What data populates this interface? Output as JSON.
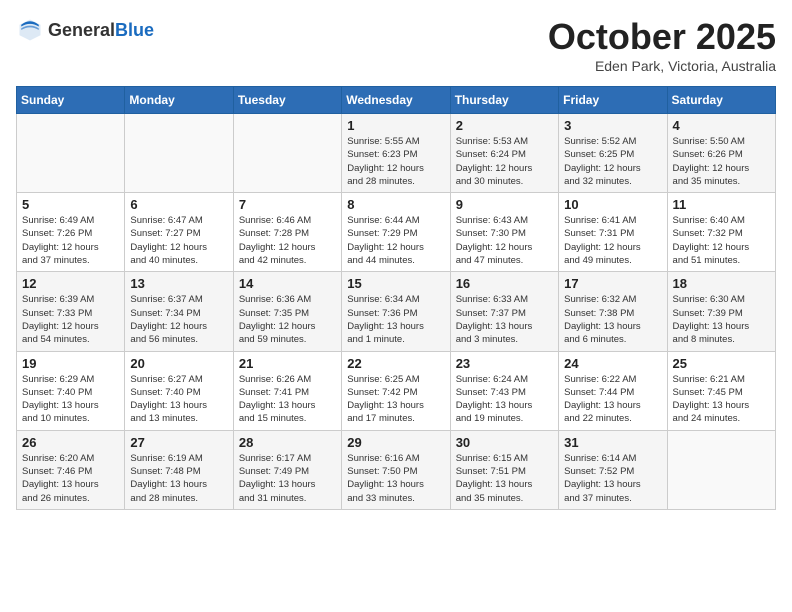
{
  "header": {
    "logo_general": "General",
    "logo_blue": "Blue",
    "title": "October 2025",
    "location": "Eden Park, Victoria, Australia"
  },
  "weekdays": [
    "Sunday",
    "Monday",
    "Tuesday",
    "Wednesday",
    "Thursday",
    "Friday",
    "Saturday"
  ],
  "weeks": [
    [
      {
        "day": "",
        "info": ""
      },
      {
        "day": "",
        "info": ""
      },
      {
        "day": "",
        "info": ""
      },
      {
        "day": "1",
        "info": "Sunrise: 5:55 AM\nSunset: 6:23 PM\nDaylight: 12 hours\nand 28 minutes."
      },
      {
        "day": "2",
        "info": "Sunrise: 5:53 AM\nSunset: 6:24 PM\nDaylight: 12 hours\nand 30 minutes."
      },
      {
        "day": "3",
        "info": "Sunrise: 5:52 AM\nSunset: 6:25 PM\nDaylight: 12 hours\nand 32 minutes."
      },
      {
        "day": "4",
        "info": "Sunrise: 5:50 AM\nSunset: 6:26 PM\nDaylight: 12 hours\nand 35 minutes."
      }
    ],
    [
      {
        "day": "5",
        "info": "Sunrise: 6:49 AM\nSunset: 7:26 PM\nDaylight: 12 hours\nand 37 minutes."
      },
      {
        "day": "6",
        "info": "Sunrise: 6:47 AM\nSunset: 7:27 PM\nDaylight: 12 hours\nand 40 minutes."
      },
      {
        "day": "7",
        "info": "Sunrise: 6:46 AM\nSunset: 7:28 PM\nDaylight: 12 hours\nand 42 minutes."
      },
      {
        "day": "8",
        "info": "Sunrise: 6:44 AM\nSunset: 7:29 PM\nDaylight: 12 hours\nand 44 minutes."
      },
      {
        "day": "9",
        "info": "Sunrise: 6:43 AM\nSunset: 7:30 PM\nDaylight: 12 hours\nand 47 minutes."
      },
      {
        "day": "10",
        "info": "Sunrise: 6:41 AM\nSunset: 7:31 PM\nDaylight: 12 hours\nand 49 minutes."
      },
      {
        "day": "11",
        "info": "Sunrise: 6:40 AM\nSunset: 7:32 PM\nDaylight: 12 hours\nand 51 minutes."
      }
    ],
    [
      {
        "day": "12",
        "info": "Sunrise: 6:39 AM\nSunset: 7:33 PM\nDaylight: 12 hours\nand 54 minutes."
      },
      {
        "day": "13",
        "info": "Sunrise: 6:37 AM\nSunset: 7:34 PM\nDaylight: 12 hours\nand 56 minutes."
      },
      {
        "day": "14",
        "info": "Sunrise: 6:36 AM\nSunset: 7:35 PM\nDaylight: 12 hours\nand 59 minutes."
      },
      {
        "day": "15",
        "info": "Sunrise: 6:34 AM\nSunset: 7:36 PM\nDaylight: 13 hours\nand 1 minute."
      },
      {
        "day": "16",
        "info": "Sunrise: 6:33 AM\nSunset: 7:37 PM\nDaylight: 13 hours\nand 3 minutes."
      },
      {
        "day": "17",
        "info": "Sunrise: 6:32 AM\nSunset: 7:38 PM\nDaylight: 13 hours\nand 6 minutes."
      },
      {
        "day": "18",
        "info": "Sunrise: 6:30 AM\nSunset: 7:39 PM\nDaylight: 13 hours\nand 8 minutes."
      }
    ],
    [
      {
        "day": "19",
        "info": "Sunrise: 6:29 AM\nSunset: 7:40 PM\nDaylight: 13 hours\nand 10 minutes."
      },
      {
        "day": "20",
        "info": "Sunrise: 6:27 AM\nSunset: 7:40 PM\nDaylight: 13 hours\nand 13 minutes."
      },
      {
        "day": "21",
        "info": "Sunrise: 6:26 AM\nSunset: 7:41 PM\nDaylight: 13 hours\nand 15 minutes."
      },
      {
        "day": "22",
        "info": "Sunrise: 6:25 AM\nSunset: 7:42 PM\nDaylight: 13 hours\nand 17 minutes."
      },
      {
        "day": "23",
        "info": "Sunrise: 6:24 AM\nSunset: 7:43 PM\nDaylight: 13 hours\nand 19 minutes."
      },
      {
        "day": "24",
        "info": "Sunrise: 6:22 AM\nSunset: 7:44 PM\nDaylight: 13 hours\nand 22 minutes."
      },
      {
        "day": "25",
        "info": "Sunrise: 6:21 AM\nSunset: 7:45 PM\nDaylight: 13 hours\nand 24 minutes."
      }
    ],
    [
      {
        "day": "26",
        "info": "Sunrise: 6:20 AM\nSunset: 7:46 PM\nDaylight: 13 hours\nand 26 minutes."
      },
      {
        "day": "27",
        "info": "Sunrise: 6:19 AM\nSunset: 7:48 PM\nDaylight: 13 hours\nand 28 minutes."
      },
      {
        "day": "28",
        "info": "Sunrise: 6:17 AM\nSunset: 7:49 PM\nDaylight: 13 hours\nand 31 minutes."
      },
      {
        "day": "29",
        "info": "Sunrise: 6:16 AM\nSunset: 7:50 PM\nDaylight: 13 hours\nand 33 minutes."
      },
      {
        "day": "30",
        "info": "Sunrise: 6:15 AM\nSunset: 7:51 PM\nDaylight: 13 hours\nand 35 minutes."
      },
      {
        "day": "31",
        "info": "Sunrise: 6:14 AM\nSunset: 7:52 PM\nDaylight: 13 hours\nand 37 minutes."
      },
      {
        "day": "",
        "info": ""
      }
    ]
  ]
}
